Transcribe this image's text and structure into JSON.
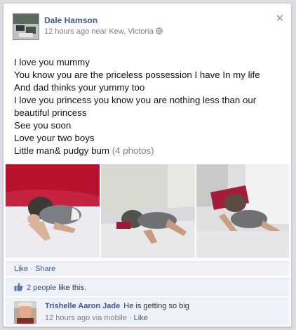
{
  "post": {
    "author": "Dale Hamson",
    "time": "12 hours ago near Kew, Victoria",
    "lines": [
      "I love you mummy",
      "You know you are the priceless possession I have In my life",
      "And dad thinks your yummy too",
      "I love you princess you know you are nothing less than our",
      "beautiful princess",
      "See you soon",
      "Love your two boys",
      "Little man& pudgy bum"
    ],
    "photo_count": "(4 photos)"
  },
  "actions": {
    "like": "Like",
    "separator": "·",
    "share": "Share"
  },
  "likes": {
    "count": "2 people",
    "suffix": "like this."
  },
  "comment": {
    "author": "Trishelle Aaron Jade",
    "text": "He is getting so big",
    "time": "12 hours ago via mobile",
    "separator": "·",
    "like": "Like"
  },
  "colors": {
    "link": "#3b5998",
    "muted": "#808080",
    "panel": "#eef1f7"
  },
  "icons": [
    "globe-icon",
    "close-icon",
    "thumbs-up-icon"
  ]
}
